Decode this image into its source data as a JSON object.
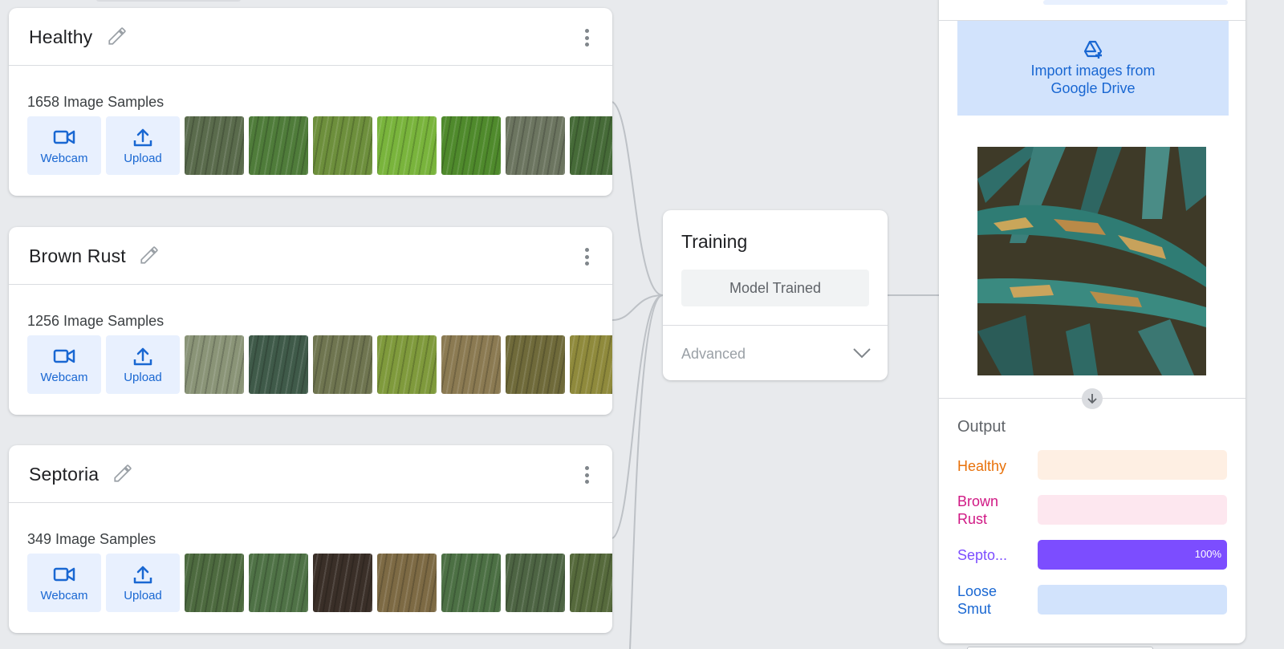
{
  "classes": [
    {
      "name": "Healthy",
      "samples": "1658 Image Samples",
      "webcam_label": "Webcam",
      "upload_label": "Upload",
      "thumbs": [
        "#5a6b4c",
        "#4f7c3a",
        "#6d8f3c",
        "#79b43c",
        "#4f8a2c",
        "#6c7560",
        "#466b38"
      ]
    },
    {
      "name": "Brown Rust",
      "samples": "1256 Image Samples",
      "webcam_label": "Webcam",
      "upload_label": "Upload",
      "thumbs": [
        "#8a9477",
        "#3f5a49",
        "#6f7550",
        "#7f9a3c",
        "#8b7a52",
        "#6f6a3a",
        "#8f8a3c"
      ]
    },
    {
      "name": "Septoria",
      "samples": "349 Image Samples",
      "webcam_label": "Webcam",
      "upload_label": "Upload",
      "thumbs": [
        "#4d6a3f",
        "#4f7246",
        "#3a2f28",
        "#7d6a44",
        "#4c7044",
        "#4d6443",
        "#566a3c"
      ]
    }
  ],
  "training": {
    "title": "Training",
    "status_button": "Model Trained",
    "advanced_label": "Advanced"
  },
  "preview": {
    "import_line1": "Import images from",
    "import_line2": "Google Drive"
  },
  "output": {
    "title": "Output",
    "rows": [
      {
        "label": "Healthy",
        "color": "#e8710a",
        "track": "#feefe3",
        "fill": "#e8710a",
        "value": 0,
        "pct": ""
      },
      {
        "label": "Brown Rust",
        "color": "#d01884",
        "track": "#fde7ef",
        "fill": "#d01884",
        "value": 0,
        "pct": ""
      },
      {
        "label": "Septo...",
        "color": "#7c4dff",
        "track": "#7c4dff",
        "fill": "#7c4dff",
        "value": 1.0,
        "pct": "100%"
      },
      {
        "label": "Loose Smut",
        "color": "#1967d2",
        "track": "#d2e3fc",
        "fill": "#1967d2",
        "value": 0,
        "pct": ""
      }
    ]
  },
  "colors": {
    "accent_blue": "#1967d2",
    "button_bg": "#e8f0fe",
    "drive_bg": "#d2e3fc"
  },
  "icons": [
    "pencil-icon",
    "more-vert-icon",
    "videocam-icon",
    "upload-icon",
    "chevron-down-icon",
    "google-drive-icon",
    "arrow-down-icon"
  ]
}
